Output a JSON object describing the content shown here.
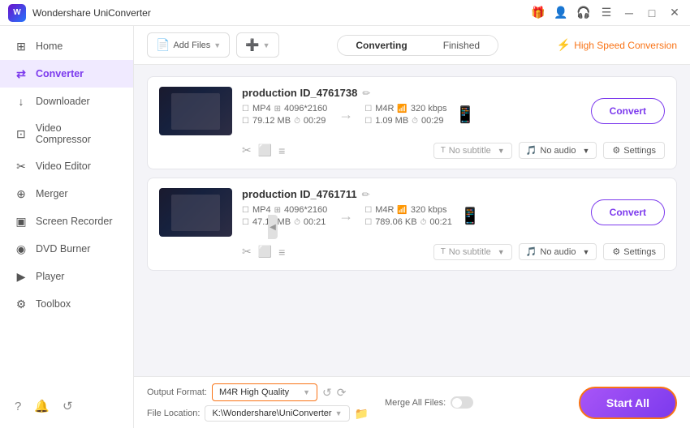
{
  "app": {
    "logo": "W",
    "title": "Wondershare UniConverter"
  },
  "titlebar": {
    "gift_icon": "🎁",
    "user_icon": "👤",
    "headset_icon": "🎧",
    "minimize": "−",
    "maximize": "□",
    "close": "✕"
  },
  "sidebar": {
    "items": [
      {
        "id": "home",
        "label": "Home",
        "icon": "⊞"
      },
      {
        "id": "converter",
        "label": "Converter",
        "icon": "⇄",
        "active": true
      },
      {
        "id": "downloader",
        "label": "Downloader",
        "icon": "↓"
      },
      {
        "id": "video-compressor",
        "label": "Video Compressor",
        "icon": "⊡"
      },
      {
        "id": "video-editor",
        "label": "Video Editor",
        "icon": "✂"
      },
      {
        "id": "merger",
        "label": "Merger",
        "icon": "⊕"
      },
      {
        "id": "screen-recorder",
        "label": "Screen Recorder",
        "icon": "▣"
      },
      {
        "id": "dvd-burner",
        "label": "DVD Burner",
        "icon": "◉"
      },
      {
        "id": "player",
        "label": "Player",
        "icon": "▶"
      },
      {
        "id": "toolbox",
        "label": "Toolbox",
        "icon": "⚙"
      }
    ],
    "bottom_icons": [
      "?",
      "🔔",
      "↺"
    ]
  },
  "toolbar": {
    "add_files_label": "Add Files",
    "add_dropdown_label": "",
    "tabs": {
      "converting": "Converting",
      "finished": "Finished"
    },
    "active_tab": "converting",
    "high_speed": "High Speed Conversion"
  },
  "files": [
    {
      "id": "file1",
      "name": "production ID_4761738",
      "from_format": "MP4",
      "from_res": "4096*2160",
      "from_size": "79.12 MB",
      "from_duration": "00:29",
      "to_format": "M4R",
      "to_bitrate": "320 kbps",
      "to_size": "1.09 MB",
      "to_duration": "00:29",
      "subtitle": "No subtitle",
      "audio": "No audio",
      "convert_label": "Convert"
    },
    {
      "id": "file2",
      "name": "production ID_4761711",
      "from_format": "MP4",
      "from_res": "4096*2160",
      "from_size": "47.14 MB",
      "from_duration": "00:21",
      "to_format": "M4R",
      "to_bitrate": "320 kbps",
      "to_size": "789.06 KB",
      "to_duration": "00:21",
      "subtitle": "No subtitle",
      "audio": "No audio",
      "convert_label": "Convert"
    }
  ],
  "bottom": {
    "output_format_label": "Output Format:",
    "output_format_value": "M4R High Quality",
    "file_location_label": "File Location:",
    "file_location_value": "K:\\Wondershare\\UniConverter",
    "merge_label": "Merge All Files:",
    "start_all_label": "Start All"
  }
}
